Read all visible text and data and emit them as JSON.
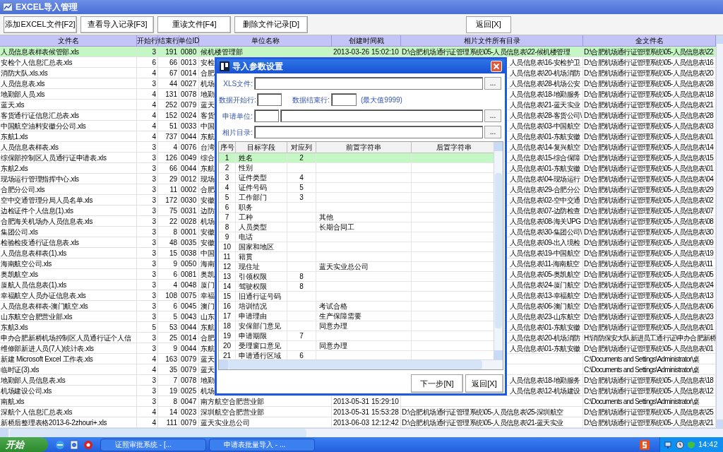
{
  "window": {
    "title": "EXCEL导入管理"
  },
  "toolbar": {
    "buttons": [
      "添加EXCEL文件[F2]",
      "查看导入记录[F3]",
      "重读文件[F4]",
      "删除文件记录[D]"
    ],
    "back_button": "返回[X]"
  },
  "table": {
    "columns": [
      "文件名",
      "开始行",
      "结束行",
      "单位ID",
      "单位名称",
      "创建时间戳",
      "相片文件所有目录",
      "全文件名"
    ],
    "rows": [
      {
        "file": "人员信息表样表候管部.xls",
        "start_row": "3",
        "end_row": "191",
        "unit_id": "0080",
        "unit_name": "候机楼管理部",
        "created": "2013-03-26 15:02:10",
        "photo_dir": "D:\\合肥机场通行证管理系统\\05-人员信息表\\22-候机楼管理",
        "full_name": "D:\\合肥机场通行证管理系统\\05-人员信息表\\22",
        "selected": true
      },
      {
        "file": "安检个人信息汇总表.xls",
        "start_row": "6",
        "end_row": "66",
        "unit_id": "0013",
        "unit_name": "安检",
        "photo_dir": "人员信息表\\16-安检护卫",
        "full_name": "D:\\合肥机场通行证管理系统\\05-人员信息表\\16",
        "selected": false
      },
      {
        "file": "消防大队.xls.xls",
        "start_row": "4",
        "end_row": "67",
        "unit_id": "0014",
        "unit_name": "合肥",
        "photo_dir": "人员信息表\\20-机场消防",
        "full_name": "D:\\合肥机场通行证管理系统\\05-人员信息表\\20",
        "selected": false
      },
      {
        "file": "人员信息表.xls",
        "start_row": "3",
        "end_row": "44",
        "unit_id": "0027",
        "unit_name": "机场",
        "photo_dir": "人员信息表\\28-机场公安",
        "full_name": "D:\\合肥机场通行证管理系统\\05-人员信息表\\28",
        "selected": false
      },
      {
        "file": "地勤部人员.xls",
        "start_row": "4",
        "end_row": "131",
        "unit_id": "0078",
        "unit_name": "地勤",
        "photo_dir": "人员信息表\\18-地勤服务",
        "full_name": "D:\\合肥机场通行证管理系统\\05-人员信息表\\18",
        "selected": false
      },
      {
        "file": "蓝天.xls",
        "start_row": "4",
        "end_row": "252",
        "unit_id": "0079",
        "unit_name": "蓝天",
        "photo_dir": "人员信息表\\21-蓝天实业",
        "full_name": "D:\\合肥机场通行证管理系统\\05-人员信息表\\21",
        "selected": false
      },
      {
        "file": "客货通行证信息汇总表.xls",
        "start_row": "4",
        "end_row": "152",
        "unit_id": "0024",
        "unit_name": "客货",
        "photo_dir": "人员信息表\\28-客货公司\\",
        "full_name": "D:\\合肥机场通行证管理系统\\05-人员信息表\\28",
        "selected": false
      },
      {
        "file": "中国航空油料安徽分公司.xls",
        "start_row": "4",
        "end_row": "51",
        "unit_id": "0033",
        "unit_name": "中国",
        "photo_dir": "人员信息表\\03-中国航空",
        "full_name": "D:\\合肥机场通行证管理系统\\05-人员信息表\\03",
        "selected": false
      },
      {
        "file": "东航1.xls",
        "start_row": "4",
        "end_row": "737",
        "unit_id": "0044",
        "unit_name": "东航",
        "photo_dir": "人员信息表\\01-东航安徽",
        "full_name": "D:\\合肥机场通行证管理系统\\05-人员信息表\\01",
        "selected": false
      },
      {
        "file": "人员信息表样表.xls",
        "start_row": "3",
        "end_row": "4",
        "unit_id": "0076",
        "unit_name": "台湾",
        "photo_dir": "人员信息表\\14-复兴航空",
        "full_name": "D:\\合肥机场通行证管理系统\\05-人员信息表\\14",
        "selected": false
      },
      {
        "file": "综保部控制区人员通行证申请表.xls",
        "start_row": "3",
        "end_row": "126",
        "unit_id": "0049",
        "unit_name": "综合",
        "photo_dir": "人员信息表\\15-综合保障",
        "full_name": "D:\\合肥机场通行证管理系统\\05-人员信息表\\15",
        "selected": false
      },
      {
        "file": "东航2.xls",
        "start_row": "3",
        "end_row": "66",
        "unit_id": "0044",
        "unit_name": "东航",
        "photo_dir": "人员信息表\\01-东航安徽",
        "full_name": "D:\\合肥机场通行证管理系统\\05-人员信息表\\01",
        "selected": false
      },
      {
        "file": "现场运行管理指挥中心.xls",
        "start_row": "3",
        "end_row": "29",
        "unit_id": "0012",
        "unit_name": "现场",
        "photo_dir": "人员信息表\\04-现场运行",
        "full_name": "D:\\合肥机场通行证管理系统\\05-人员信息表\\04",
        "selected": false
      },
      {
        "file": "合肥分公司.xls",
        "start_row": "3",
        "end_row": "11",
        "unit_id": "0002",
        "unit_name": "合肥",
        "photo_dir": "人员信息表\\29-合肥分公",
        "full_name": "D:\\合肥机场通行证管理系统\\05-人员信息表\\29",
        "selected": false
      },
      {
        "file": "空中交通管理分局人员名单.xls",
        "start_row": "3",
        "end_row": "172",
        "unit_id": "0030",
        "unit_name": "安徽",
        "photo_dir": "人员信息表\\02-空中交通",
        "full_name": "D:\\合肥机场通行证管理系统\\05-人员信息表\\02",
        "selected": false
      },
      {
        "file": "边检证件个人信息(1).xls",
        "start_row": "3",
        "end_row": "75",
        "unit_id": "0031",
        "unit_name": "边防",
        "photo_dir": "人员信息表\\07-边防检查",
        "full_name": "D:\\合肥机场通行证管理系统\\05-人员信息表\\07",
        "selected": false
      },
      {
        "file": "合肥海关机场办人员信息表.xls",
        "start_row": "3",
        "end_row": "22",
        "unit_id": "0028",
        "unit_name": "机场",
        "photo_dir": "人员信息表\\08-海关\\JPG",
        "full_name": "D:\\合肥机场通行证管理系统\\05-人员信息表\\08",
        "selected": false
      },
      {
        "file": "集团公司.xls",
        "start_row": "3",
        "end_row": "8",
        "unit_id": "0001",
        "unit_name": "安徽",
        "photo_dir": "人员信息表\\30-集团公司\\",
        "full_name": "D:\\合肥机场通行证管理系统\\05-人员信息表\\30",
        "selected": false
      },
      {
        "file": "检验检疫通行证信息表.xls",
        "start_row": "3",
        "end_row": "48",
        "unit_id": "0035",
        "unit_name": "安徽",
        "photo_dir": "人员信息表\\09-出入境检",
        "full_name": "D:\\合肥机场通行证管理系统\\05-人员信息表\\09",
        "selected": false
      },
      {
        "file": "人员信息表样表(1).xls",
        "start_row": "3",
        "end_row": "15",
        "unit_id": "0038",
        "unit_name": "中国",
        "photo_dir": "人员信息表\\19-中国航空",
        "full_name": "D:\\合肥机场通行证管理系统\\05-人员信息表\\19",
        "selected": false
      },
      {
        "file": "海南航空公司.xls",
        "start_row": "3",
        "end_row": "9",
        "unit_id": "0050",
        "unit_name": "海南",
        "photo_dir": "人员信息表\\11-海南航空",
        "full_name": "D:\\合肥机场通行证管理系统\\05-人员信息表\\11",
        "selected": false
      },
      {
        "file": "奥凯航空.xls",
        "start_row": "3",
        "end_row": "6",
        "unit_id": "0081",
        "unit_name": "奥凯",
        "photo_dir": "人员信息表\\05-奥凯航空",
        "full_name": "D:\\合肥机场通行证管理系统\\05-人员信息表\\05",
        "selected": false
      },
      {
        "file": "厦航人员信息表(1).xls",
        "start_row": "3",
        "end_row": "4",
        "unit_id": "0048",
        "unit_name": "厦门",
        "photo_dir": "人员信息表\\24-厦门航空",
        "full_name": "D:\\合肥机场通行证管理系统\\05-人员信息表\\24",
        "selected": false
      },
      {
        "file": "幸福航空人员办证信息表.xls",
        "start_row": "3",
        "end_row": "108",
        "unit_id": "0075",
        "unit_name": "幸福",
        "photo_dir": "人员信息表\\13-幸福航空",
        "full_name": "D:\\合肥机场通行证管理系统\\05-人员信息表\\13",
        "selected": false
      },
      {
        "file": "人员信息表样表-澳门航空.xls",
        "start_row": "3",
        "end_row": "6",
        "unit_id": "0045",
        "unit_name": "澳门",
        "photo_dir": "人员信息表\\06-澳门航空",
        "full_name": "D:\\合肥机场通行证管理系统\\05-人员信息表\\06",
        "selected": false
      },
      {
        "file": "山东航空合肥营业部.xls",
        "start_row": "3",
        "end_row": "5",
        "unit_id": "0043",
        "unit_name": "山东",
        "photo_dir": "人员信息表\\23-山东航空",
        "full_name": "D:\\合肥机场通行证管理系统\\05-人员信息表\\23",
        "selected": false
      },
      {
        "file": "东航3.xls",
        "start_row": "5",
        "end_row": "53",
        "unit_id": "0044",
        "unit_name": "东航",
        "photo_dir": "人员信息表\\01-东航安徽",
        "full_name": "D:\\合肥机场通行证管理系统\\05-人员信息表\\01",
        "selected": false
      },
      {
        "file": "申办合肥新桥机场控制区人员通行证个人信",
        "start_row": "3",
        "end_row": "25",
        "unit_id": "0014",
        "unit_name": "合肥",
        "photo_dir": "人员信息表\\20-机场消防",
        "full_name": "H:\\消防保安大队新进员工通行证\\申办合肥新桥",
        "selected": false
      },
      {
        "file": "维修部新进人员(7人)统计表.xls",
        "start_row": "3",
        "end_row": "9",
        "unit_id": "0044",
        "unit_name": "东航",
        "photo_dir": "人员信息表\\01-东航安徽",
        "full_name": "D:\\合肥机场通行证管理系统\\05-人员信息表\\01",
        "selected": false
      },
      {
        "file": "新建 Microsoft Excel 工作表.xls",
        "start_row": "4",
        "end_row": "163",
        "unit_id": "0079",
        "unit_name": "蓝天",
        "full_name": "C:\\Documents and Settings\\Administrator\\桌",
        "selected": false
      },
      {
        "file": "临时证(3).xls",
        "start_row": "4",
        "end_row": "35",
        "unit_id": "0079",
        "unit_name": "蓝天",
        "full_name": "C:\\Documents and Settings\\Administrator\\桌",
        "selected": false
      },
      {
        "file": "地勤部人员信息表.xls",
        "start_row": "3",
        "end_row": "7",
        "unit_id": "0078",
        "unit_name": "地勤",
        "photo_dir": "人员信息表\\18-地勤服务",
        "full_name": "D:\\合肥机场通行证管理系统\\05-人员信息表\\18",
        "selected": false
      },
      {
        "file": "机场建设公司.xls",
        "start_row": "3",
        "end_row": "19",
        "unit_id": "0025",
        "unit_name": "机场",
        "photo_dir": "人员信息表\\12-机场建设",
        "full_name": "D:\\合肥机场通行证管理系统\\05-人员信息表\\12",
        "selected": false
      },
      {
        "file": "南航.xls",
        "start_row": "3",
        "end_row": "8",
        "unit_id": "0047",
        "unit_name": "南方航空合肥营业部",
        "created": "2013-05-31 15:29:10",
        "full_name": "C:\\Documents and Settings\\Administrator\\桌",
        "selected": false
      },
      {
        "file": "深航个人信息汇总表.xls",
        "start_row": "4",
        "end_row": "14",
        "unit_id": "0023",
        "unit_name": "深圳航空合肥营业部",
        "created": "2013-05-31 15:53:28",
        "photo_dir": "D:\\合肥机场通行证管理系统\\05-人员信息表\\25-深圳航空",
        "full_name": "D:\\合肥机场通行证管理系统\\05-人员信息表\\25",
        "selected": false
      },
      {
        "file": "新桥后整理表格2013-6-2zhouri+.xls",
        "start_row": "4",
        "end_row": "111",
        "unit_id": "0079",
        "unit_name": "蓝天实业总公司",
        "created": "2013-06-03 12:12:42",
        "photo_dir": "D:\\合肥机场通行证管理系统\\05-人员信息表\\21-蓝天实业",
        "full_name": "D:\\合肥机场通行证管理系统\\05-人员信息表\\21",
        "selected": false
      }
    ]
  },
  "dialog": {
    "title": "导入参数设置",
    "xls_label": "XLS文件:",
    "start_label": "数据开始行:",
    "end_label": "数据结束行:",
    "max_hint": "(最大值9999)",
    "unit_label": "申请单位:",
    "photo_label": "相片目录:",
    "browse": "...",
    "grid": {
      "columns": [
        "序号",
        "目标字段",
        "对应列",
        "前置字符串",
        "后置字符串"
      ],
      "rows": [
        {
          "no": "1",
          "field": "姓名",
          "column": "2",
          "selected": true
        },
        {
          "no": "2",
          "field": "性别",
          "selected": false
        },
        {
          "no": "3",
          "field": "证件类型",
          "column": "4",
          "selected": false
        },
        {
          "no": "4",
          "field": "证件号码",
          "column": "5",
          "selected": false
        },
        {
          "no": "5",
          "field": "工作部门",
          "column": "3",
          "selected": false
        },
        {
          "no": "6",
          "field": "职务",
          "selected": false
        },
        {
          "no": "7",
          "field": "工种",
          "prefix": "其他",
          "selected": false
        },
        {
          "no": "8",
          "field": "人员类型",
          "prefix": "长期合同工",
          "selected": false
        },
        {
          "no": "9",
          "field": "电话",
          "selected": false
        },
        {
          "no": "10",
          "field": "国家和地区",
          "selected": false
        },
        {
          "no": "11",
          "field": "籍贯",
          "selected": false
        },
        {
          "no": "12",
          "field": "现住址",
          "prefix": "蓝天实业总公司",
          "selected": false
        },
        {
          "no": "13",
          "field": "引领权限",
          "column": "8",
          "selected": false
        },
        {
          "no": "14",
          "field": "驾驶权限",
          "column": "8",
          "selected": false
        },
        {
          "no": "15",
          "field": "旧通行证号码",
          "selected": false
        },
        {
          "no": "16",
          "field": "培训情况",
          "prefix": "考试合格",
          "selected": false
        },
        {
          "no": "17",
          "field": "申请理由",
          "prefix": "生产保障需要",
          "selected": false
        },
        {
          "no": "18",
          "field": "安保部门意见",
          "prefix": "同意办理",
          "selected": false
        },
        {
          "no": "19",
          "field": "申请期限",
          "column": "7",
          "selected": false
        },
        {
          "no": "20",
          "field": "受理窗口意见",
          "prefix": "同意办理",
          "selected": false
        },
        {
          "no": "21",
          "field": "申请通行区域",
          "column": "6",
          "selected": false
        }
      ]
    },
    "buttons": [
      "下一步[N]",
      "返回[X]"
    ]
  },
  "taskbar": {
    "start": "开始",
    "tasks": [
      "证照审批系统 - [...",
      "申请表批量导入 - ..."
    ],
    "clock": "14:42"
  }
}
